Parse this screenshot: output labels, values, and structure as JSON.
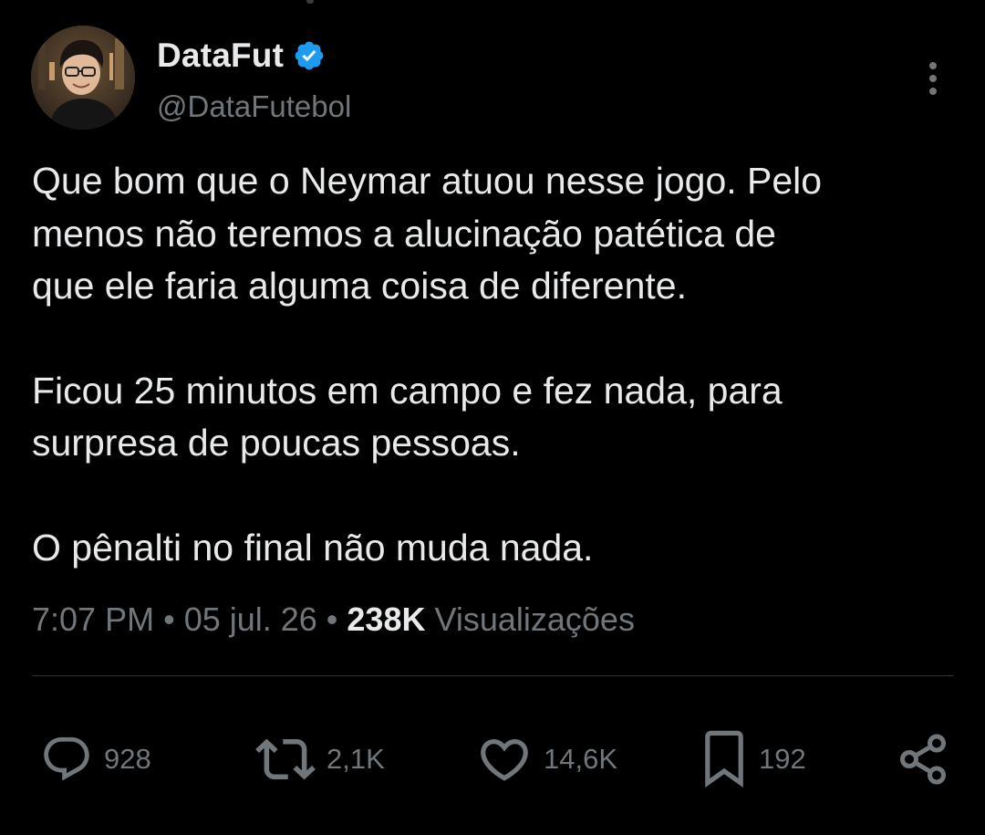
{
  "author": {
    "display_name": "DataFut",
    "handle": "@DataFutebol",
    "verified": true,
    "verified_color": "#1d9bf0"
  },
  "tweet": {
    "paragraphs": [
      "Que bom que o Neymar atuou nesse jogo. Pelo\nmenos não teremos a alucinação patética de\nque ele faria alguma coisa de diferente.",
      "Ficou 25 minutos em campo e fez nada, para\nsurpresa de poucas pessoas.",
      "O pênalti no final não muda nada."
    ]
  },
  "meta": {
    "time": "7:07 PM",
    "date": "05 jul. 26",
    "separator": " • ",
    "views_count": "238K",
    "views_label": "Visualizações"
  },
  "actions": {
    "reply": {
      "icon": "reply-icon",
      "count": "928"
    },
    "retweet": {
      "icon": "retweet-icon",
      "count": "2,1K"
    },
    "like": {
      "icon": "heart-icon",
      "count": "14,6K"
    },
    "bookmark": {
      "icon": "bookmark-icon",
      "count": "192"
    },
    "share": {
      "icon": "share-icon"
    }
  },
  "colors": {
    "background": "#000000",
    "text_primary": "#e7e9ea",
    "text_secondary": "#71767b",
    "divider": "#2f3336"
  }
}
